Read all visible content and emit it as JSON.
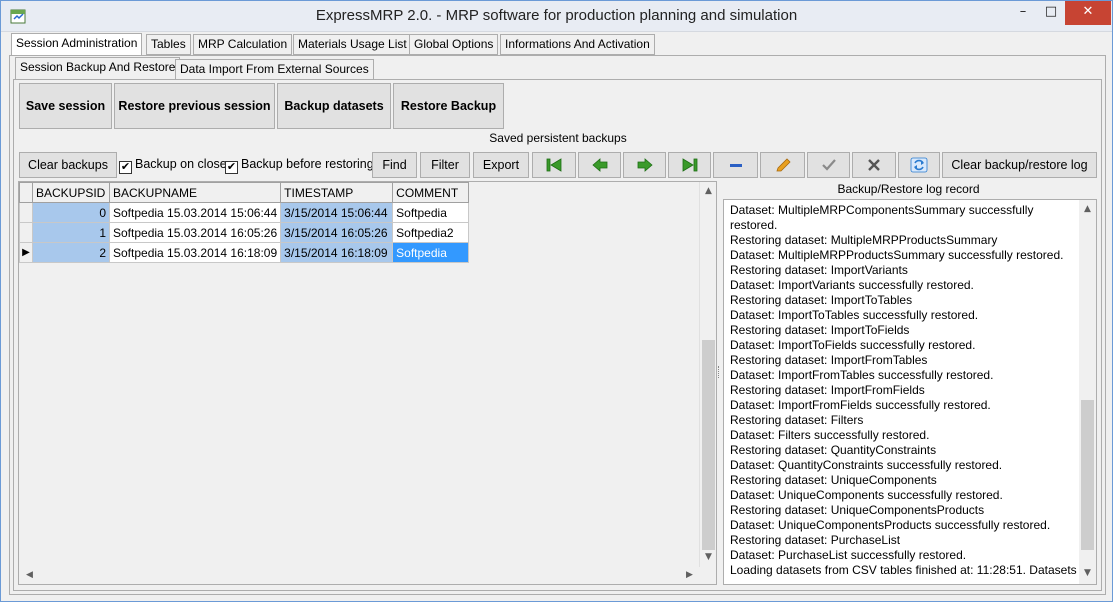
{
  "window": {
    "title": "ExpressMRP 2.0. - MRP software for production planning and simulation",
    "minimize": "–",
    "maximize": "□",
    "close": "✕"
  },
  "main_tabs": [
    "Session Administration",
    "Tables",
    "MRP Calculation",
    "Materials Usage List",
    "Global Options",
    "Informations And Activation"
  ],
  "sub_tabs": [
    "Session Backup And Restore",
    "Data Import From External Sources"
  ],
  "actions": {
    "save_session": "Save session",
    "restore_previous": "Restore previous session",
    "backup_datasets": "Backup datasets",
    "restore_backup": "Restore Backup"
  },
  "backups_caption": "Saved persistent backups",
  "toolbar": {
    "clear_backups": "Clear backups",
    "backup_on_close": "Backup on close",
    "backup_before_restoring": "Backup before restoring",
    "find": "Find",
    "filter": "Filter",
    "export": "Export",
    "clear_log": "Clear backup/restore log"
  },
  "checkbox_state": {
    "backup_on_close": "✔",
    "backup_before_restoring": "✔"
  },
  "grid": {
    "columns": [
      "BACKUPSID",
      "BACKUPNAME",
      "TIMESTAMP",
      "COMMENT"
    ],
    "rows": [
      [
        "0",
        "Softpedia 15.03.2014 15:06:44",
        "3/15/2014 15:06:44",
        "Softpedia"
      ],
      [
        "1",
        "Softpedia 15.03.2014 16:05:26",
        "3/15/2014 16:05:26",
        "Softpedia2"
      ],
      [
        "2",
        "Softpedia 15.03.2014 16:18:09",
        "3/15/2014 16:18:09",
        "Softpedia"
      ]
    ],
    "current_row_marker": "▶"
  },
  "log": {
    "title": "Backup/Restore log record",
    "lines": [
      "Dataset: MultipleMRPComponentsSummary successfully",
      "restored.",
      "Restoring dataset: MultipleMRPProductsSummary",
      "Dataset: MultipleMRPProductsSummary successfully restored.",
      "Restoring dataset: ImportVariants",
      "Dataset: ImportVariants successfully restored.",
      "Restoring dataset: ImportToTables",
      "Dataset: ImportToTables successfully restored.",
      "Restoring dataset: ImportToFields",
      "Dataset: ImportToFields successfully restored.",
      "Restoring dataset: ImportFromTables",
      "Dataset: ImportFromTables successfully restored.",
      "Restoring dataset: ImportFromFields",
      "Dataset: ImportFromFields successfully restored.",
      "Restoring dataset: Filters",
      "Dataset: Filters successfully restored.",
      "Restoring dataset: QuantityConstraints",
      "Dataset: QuantityConstraints successfully restored.",
      "Restoring dataset: UniqueComponents",
      "Dataset: UniqueComponents successfully restored.",
      "Restoring dataset: UniqueComponentsProducts",
      "Dataset: UniqueComponentsProducts successfully restored.",
      "Restoring dataset: PurchaseList",
      "Dataset: PurchaseList successfully restored.",
      "Loading datasets from CSV tables finished at: 11:28:51. Datasets"
    ]
  },
  "colors": {
    "nav_green": "#3a9a2a",
    "nav_arrow_border": "#1d6e14",
    "minus_blue": "#2a5fc4",
    "pencil_orange": "#e8a020",
    "refresh_blue": "#2a7bd0"
  },
  "icons": [
    "first-record-icon",
    "prior-record-icon",
    "next-record-icon",
    "last-record-icon",
    "delete-record-icon",
    "edit-record-icon",
    "post-edit-icon",
    "cancel-edit-icon",
    "refresh-icon"
  ]
}
